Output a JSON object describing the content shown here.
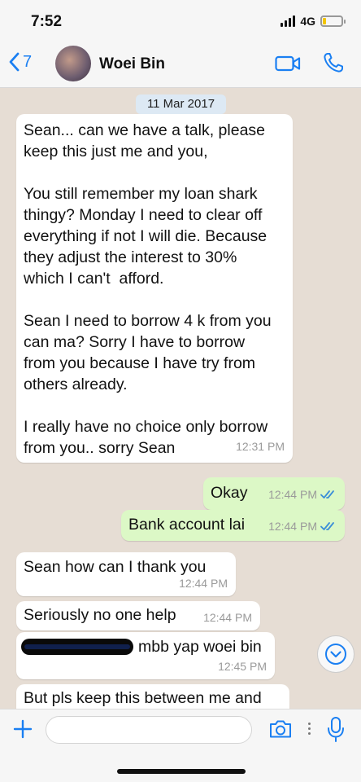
{
  "status": {
    "time": "7:52",
    "network": "4G",
    "battery_fraction": 0.2,
    "colors": {
      "battery": "#f2c500"
    }
  },
  "header": {
    "back_count": "7",
    "contact_name": "Woei Bin",
    "icons": [
      "chevron-left-icon",
      "video-call-icon",
      "phone-call-icon"
    ],
    "accent_color": "#1a7ff2"
  },
  "chat": {
    "date": "11 Mar 2017",
    "messages": [
      {
        "direction": "in",
        "text": "Sean... can we have a talk, please\nkeep this just me and you,\n\nYou still remember my loan shark\nthingy? Monday I need to clear off\neverything if not I will die. Because\nthey adjust the interest to 30%\nwhich I can't  afford.\n\nSean I need to borrow 4 k from you\ncan ma? Sorry I have to borrow\nfrom you because I have try from\nothers already.\n\nI really have no choice only borrow\nfrom you.. sorry Sean",
        "time": "12:31 PM"
      },
      {
        "direction": "out",
        "text": "Okay",
        "time": "12:44 PM",
        "read": true
      },
      {
        "direction": "out",
        "text": "Bank account lai",
        "time": "12:44 PM",
        "read": true
      },
      {
        "direction": "in",
        "text": "Sean how can I thank you",
        "time": "12:44 PM"
      },
      {
        "direction": "in",
        "text": "Seriously no one help",
        "time": "12:44 PM"
      },
      {
        "direction": "in",
        "text": "mbb yap woei bin",
        "time": "12:45 PM",
        "redacted_prefix": true
      },
      {
        "direction": "in",
        "text": "But pls keep this between me and",
        "time": ""
      }
    ],
    "colors": {
      "incoming": "#ffffff",
      "outgoing": "#dcf8c6",
      "background": "#e6ddd4",
      "read_ticks": "#3b8ed8"
    }
  },
  "input": {
    "placeholder": "",
    "icons": [
      "plus-icon",
      "camera-icon",
      "more-dots-icon",
      "microphone-icon"
    ]
  }
}
